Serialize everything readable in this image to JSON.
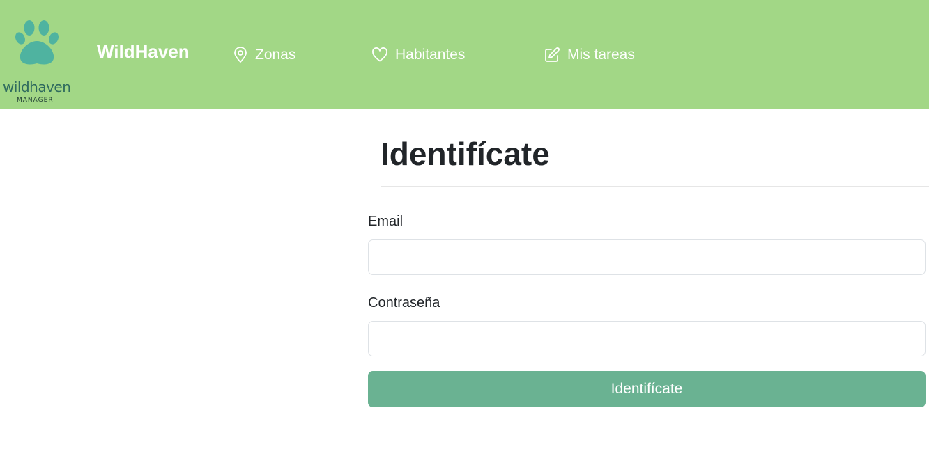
{
  "navbar": {
    "logo": {
      "word": "wildhaven",
      "sub": "MANAGER",
      "icon": "paw-icon",
      "color": "#4fb3a0"
    },
    "brand": "WildHaven",
    "items": [
      {
        "label": "Zonas",
        "icon": "map-pin-icon"
      },
      {
        "label": "Habitantes",
        "icon": "heart-icon"
      },
      {
        "label": "Mis tareas",
        "icon": "edit-icon"
      }
    ],
    "background": "#a2d786"
  },
  "form": {
    "title": "Identifícate",
    "email_label": "Email",
    "email_value": "",
    "password_label": "Contraseña",
    "password_value": "",
    "submit_label": "Identifícate",
    "submit_color": "#6ab292"
  }
}
